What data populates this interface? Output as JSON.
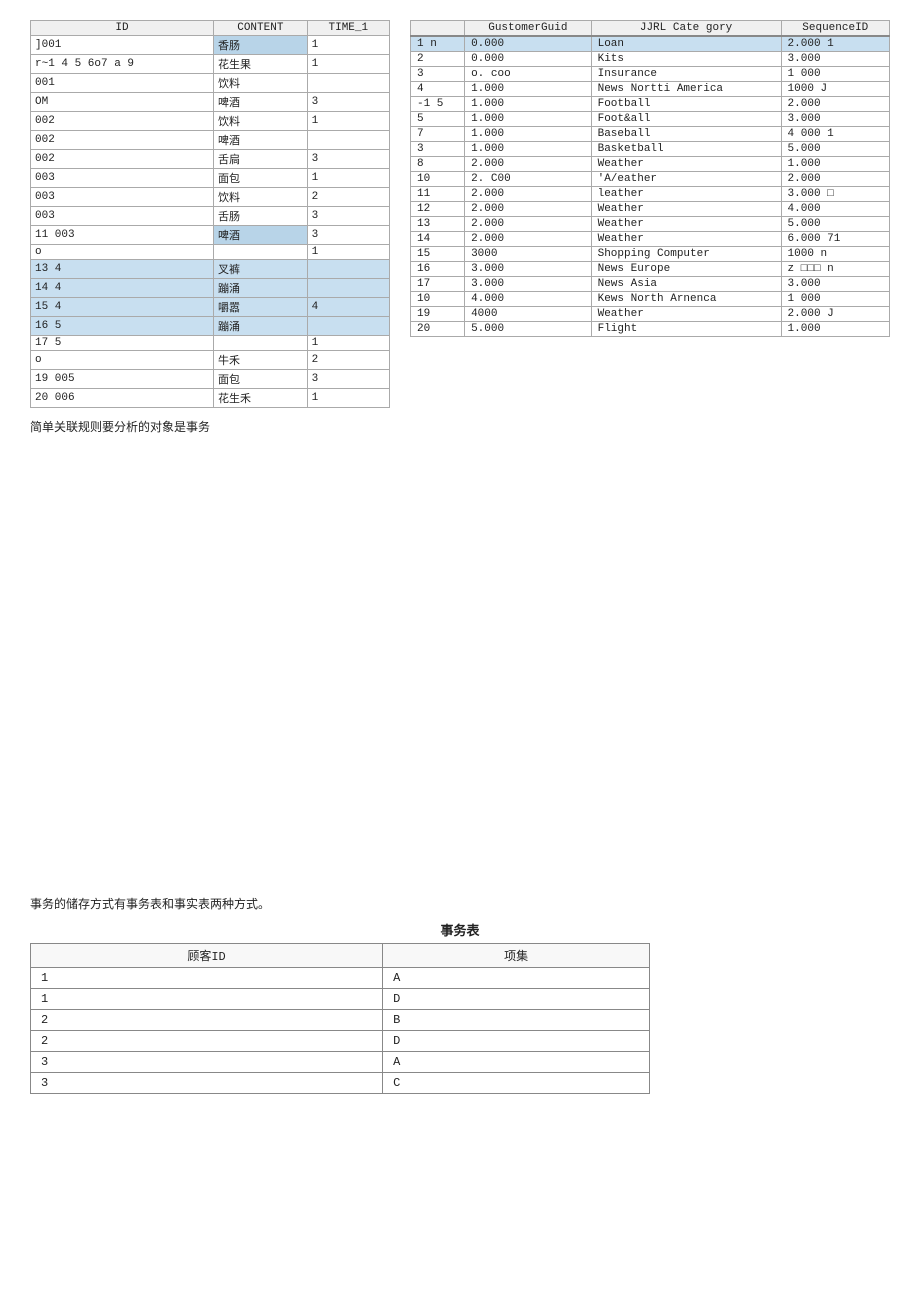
{
  "left_table": {
    "headers": [
      "ID",
      "CONTENT",
      "TIME_1"
    ],
    "rows": [
      {
        "id": "]001",
        "content": "香肠",
        "time": "1",
        "highlight_content": true
      },
      {
        "id": "r~1 4 5 6o7 a 9",
        "content": "花生果",
        "time": "1",
        "highlight_content": false
      },
      {
        "id": "001",
        "content": "饮料",
        "time": "",
        "highlight_content": false
      },
      {
        "id": "OM",
        "content": "啤酒",
        "time": "3",
        "highlight_content": false
      },
      {
        "id": "002",
        "content": "饮料",
        "time": "1",
        "highlight_content": false
      },
      {
        "id": "002",
        "content": "啤酒",
        "time": "",
        "highlight_content": false
      },
      {
        "id": "002",
        "content": "舌扃",
        "time": "3",
        "highlight_content": false
      },
      {
        "id": "003",
        "content": "面包",
        "time": "1",
        "highlight_content": false
      },
      {
        "id": "003",
        "content": "饮料",
        "time": "2",
        "highlight_content": false
      },
      {
        "id": "003",
        "content": "舌肠",
        "time": "3",
        "highlight_content": false
      },
      {
        "id": "11",
        "id2": "003",
        "content": "啤酒",
        "time": "3",
        "highlight_content": true
      },
      {
        "id": "",
        "id2": "o",
        "content": "",
        "time": "1",
        "highlight_content": false
      },
      {
        "id": "13",
        "id2": "4",
        "content": "叉裤",
        "time": "",
        "highlight_content": false,
        "selected": true
      },
      {
        "id": "14",
        "id2": "4",
        "content": "蹦涌",
        "time": "",
        "highlight_content": false,
        "selected": true
      },
      {
        "id": "15",
        "id2": "4",
        "content": "嚼器",
        "time": "4",
        "highlight_content": false,
        "selected": true
      },
      {
        "id": "16",
        "id2": "5",
        "content": "蹦涌",
        "time": "",
        "highlight_content": false,
        "selected": true
      },
      {
        "id": "17",
        "id2": "5",
        "content": "",
        "time": "1",
        "highlight_content": false
      },
      {
        "id": "",
        "id2": "o",
        "content": "H牛;禾",
        "time": "2",
        "highlight_content": false
      },
      {
        "id": "19",
        "id2": "005",
        "content": "面包",
        "time": "3",
        "highlight_content": false
      },
      {
        "id": "20",
        "id2": "006",
        "content": "花生禾",
        "time": "1",
        "highlight_content": false
      }
    ]
  },
  "right_table": {
    "headers": [
      "",
      "GustomerGuid",
      "JJRL Cate gory",
      "SequenceID"
    ],
    "rows": [
      {
        "id": "1 n",
        "guid": "0.000",
        "category": "Loan",
        "seq": "2.000",
        "extra": "1",
        "highlight": true
      },
      {
        "id": "2",
        "guid": "0.000",
        "category": "Kits",
        "seq": "3.000",
        "extra": ""
      },
      {
        "id": "3",
        "guid": "o. coo",
        "category": "Insurance",
        "seq": "1 000",
        "extra": ""
      },
      {
        "id": "4",
        "guid": "1.000",
        "category": "News Nortti America",
        "seq": "1000 J",
        "extra": ""
      },
      {
        "id": "5",
        "guid": "1.000",
        "category": "Football",
        "seq": "2.000",
        "extra": "",
        "prefix": "-1"
      },
      {
        "id": "5",
        "guid": "1.000",
        "category": "Foot&all",
        "seq": "3.000",
        "extra": ""
      },
      {
        "id": "7",
        "guid": "1.000",
        "category": "Baseball",
        "seq": "4 000",
        "extra": "1"
      },
      {
        "id": "3",
        "guid": "1.000",
        "category": "Basketball",
        "seq": "5.000",
        "extra": ""
      },
      {
        "id": "8",
        "guid": "2.000",
        "category": "Weather",
        "seq": "1.000",
        "extra": "",
        "underline": true
      },
      {
        "id": "10",
        "guid": "2. C00",
        "category": "'A/eather",
        "seq": "2.000",
        "extra": ""
      },
      {
        "id": "11",
        "guid": "2.000",
        "category": "leather",
        "seq": "3.000 □",
        "extra": ""
      },
      {
        "id": "12",
        "guid": "2.000",
        "category": "Weather",
        "seq": "4.000",
        "extra": ""
      },
      {
        "id": "13",
        "guid": "2.000",
        "category": "Weather",
        "seq": "5.000",
        "extra": ""
      },
      {
        "id": "14",
        "guid": "2.000",
        "category": "Weather",
        "seq": "6.000",
        "extra": "71"
      },
      {
        "id": "15",
        "guid": "3000",
        "category": "Shopping Computer",
        "seq": "1000 n",
        "extra": ""
      },
      {
        "id": "16",
        "guid": "3.000",
        "category": "News Europe",
        "seq": "z □□□ n",
        "extra": ""
      },
      {
        "id": "17",
        "guid": "3.000",
        "category": "News Asia",
        "seq": "3.000",
        "extra": ""
      },
      {
        "id": "10",
        "guid": "4.000",
        "category": "Kews North Arnenca",
        "seq": "1 000",
        "extra": ""
      },
      {
        "id": "19",
        "guid": "4000",
        "category": "Weather",
        "seq": "2.000 J",
        "extra": ""
      },
      {
        "id": "20",
        "guid": "5.000",
        "category": "Flight",
        "seq": "1.000",
        "extra": ""
      }
    ]
  },
  "note": "简单关联规则要分析的对象是事务",
  "bottom_note": "事务的储存方式有事务表和事实表两种方式。",
  "transaction_table_title": "事务表",
  "transaction_table": {
    "headers": [
      "顾客ID",
      "项集"
    ],
    "rows": [
      {
        "customer": "1",
        "items": "A"
      },
      {
        "customer": "1",
        "items": "D"
      },
      {
        "customer": "2",
        "items": "B"
      },
      {
        "customer": "2",
        "items": "D"
      },
      {
        "customer": "3",
        "items": "A"
      },
      {
        "customer": "3",
        "items": "C"
      }
    ]
  }
}
